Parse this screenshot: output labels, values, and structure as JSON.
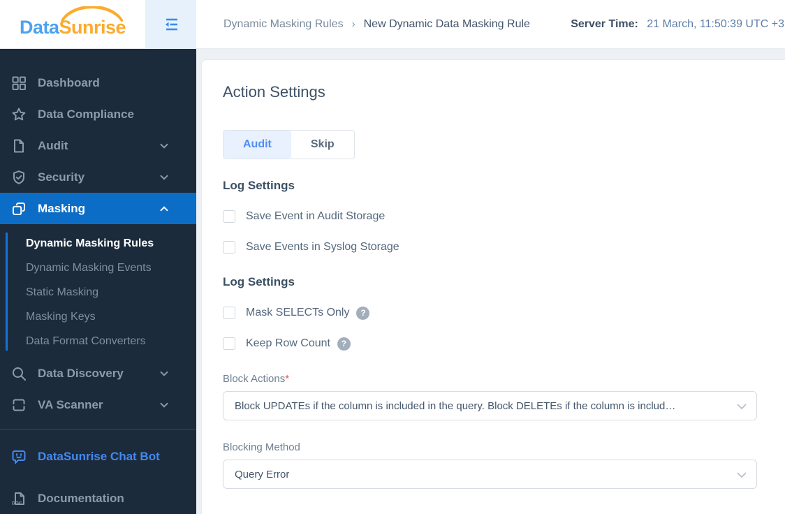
{
  "header": {
    "logo": {
      "part1": "Data",
      "part2": "Sunrise"
    },
    "breadcrumb": {
      "parent": "Dynamic Masking Rules",
      "separator": "›",
      "current": "New Dynamic Data Masking Rule"
    },
    "server_time": {
      "label": "Server Time:",
      "value": "21 March, 11:50:39  UTC +3"
    }
  },
  "sidebar": {
    "items": [
      {
        "label": "Dashboard",
        "icon": "dashboard-icon"
      },
      {
        "label": "Data Compliance",
        "icon": "star-icon"
      },
      {
        "label": "Audit",
        "icon": "document-icon",
        "chevron": "down"
      },
      {
        "label": "Security",
        "icon": "shield-icon",
        "chevron": "down"
      },
      {
        "label": "Masking",
        "icon": "mask-icon",
        "chevron": "up",
        "active": true
      }
    ],
    "masking_submenu": [
      {
        "label": "Dynamic Masking Rules",
        "active": true
      },
      {
        "label": "Dynamic Masking Events"
      },
      {
        "label": "Static Masking"
      },
      {
        "label": "Masking Keys"
      },
      {
        "label": "Data Format Converters"
      }
    ],
    "items_lower": [
      {
        "label": "Data Discovery",
        "icon": "search-icon",
        "chevron": "down"
      },
      {
        "label": "VA Scanner",
        "icon": "scanner-icon",
        "chevron": "down"
      }
    ],
    "footer_items": [
      {
        "label": "DataSunrise Chat Bot",
        "icon": "chat-bot-icon"
      },
      {
        "label": "Documentation",
        "icon": "doc-icon"
      }
    ]
  },
  "main": {
    "title": "Action Settings",
    "tabs": [
      {
        "label": "Audit",
        "active": true
      },
      {
        "label": "Skip",
        "active": false
      }
    ],
    "help_glyph": "?",
    "sections": [
      {
        "heading": "Log Settings",
        "checkboxes": [
          {
            "label": "Save Event in Audit Storage",
            "checked": false
          },
          {
            "label": "Save Events in Syslog Storage",
            "checked": false
          }
        ]
      },
      {
        "heading": "Log Settings",
        "checkboxes": [
          {
            "label": "Mask SELECTs Only",
            "checked": false,
            "help": true
          },
          {
            "label": "Keep Row Count",
            "checked": false,
            "help": true
          }
        ]
      }
    ],
    "fields": [
      {
        "label": "Block Actions",
        "required_mark": "*",
        "value": "Block UPDATEs if the column is included in the query. Block DELETEs if the column is includ…"
      },
      {
        "label": "Blocking Method",
        "required_mark": "",
        "value": "Query Error"
      }
    ]
  },
  "colors": {
    "brand_blue": "#4da1f0",
    "brand_orange": "#fbab2e",
    "sidebar_bg": "#1c2b3c",
    "active_item_bg": "#0c6dc7",
    "accent_blue": "#4e8df5",
    "tab_active_bg": "#e8f1fd",
    "required_red": "#e05252"
  }
}
